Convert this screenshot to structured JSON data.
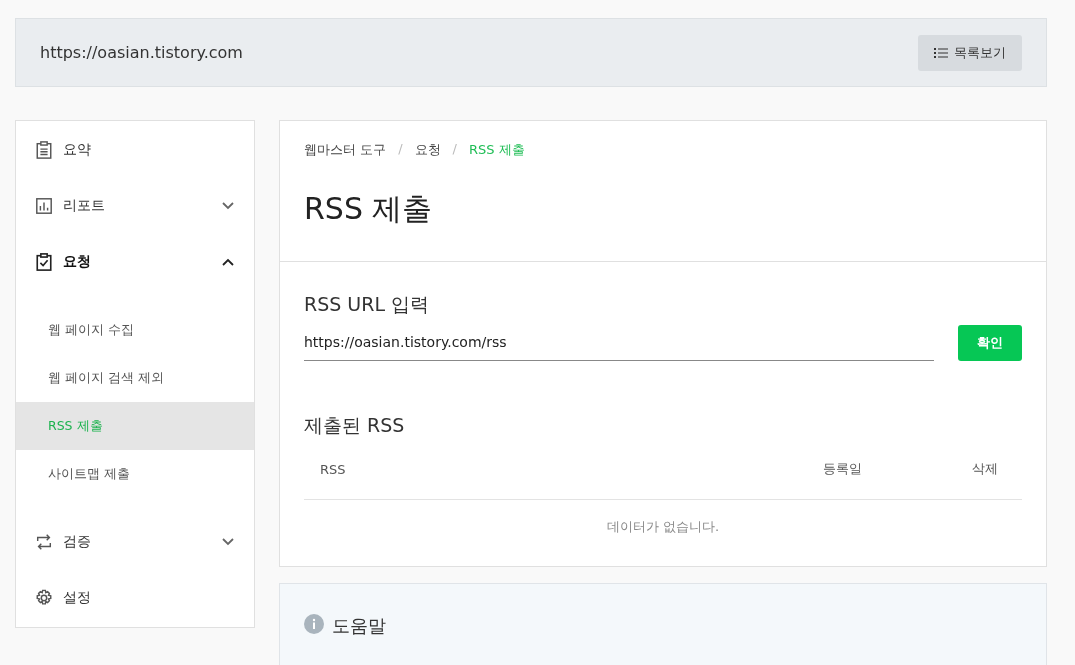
{
  "header": {
    "site_url": "https://oasian.tistory.com",
    "list_button": "목록보기"
  },
  "sidebar": {
    "items": [
      {
        "label": "요약",
        "selected": false
      },
      {
        "label": "리포트",
        "selected": false,
        "expanded": false
      },
      {
        "label": "요청",
        "selected": true,
        "expanded": true,
        "children": [
          {
            "label": "웹 페이지 수집",
            "selected": false
          },
          {
            "label": "웹 페이지 검색 제외",
            "selected": false
          },
          {
            "label": "RSS 제출",
            "selected": true
          },
          {
            "label": "사이트맵 제출",
            "selected": false
          }
        ]
      },
      {
        "label": "검증",
        "selected": false,
        "expanded": false
      },
      {
        "label": "설정",
        "selected": false
      }
    ]
  },
  "breadcrumb": [
    {
      "label": "웹마스터 도구",
      "selected": false
    },
    {
      "label": "요청",
      "selected": false
    },
    {
      "label": "RSS 제출",
      "selected": true
    }
  ],
  "breadcrumb_separator": "/",
  "page_title": "RSS 제출",
  "rss_form": {
    "label": "RSS URL 입력",
    "value": "https://oasian.tistory.com/rss",
    "submit_button": "확인"
  },
  "submitted": {
    "title": "제출된 RSS",
    "columns": [
      "RSS",
      "등록일",
      "삭제"
    ],
    "empty_message": "데이터가 없습니다."
  },
  "help": {
    "title": "도움말"
  }
}
